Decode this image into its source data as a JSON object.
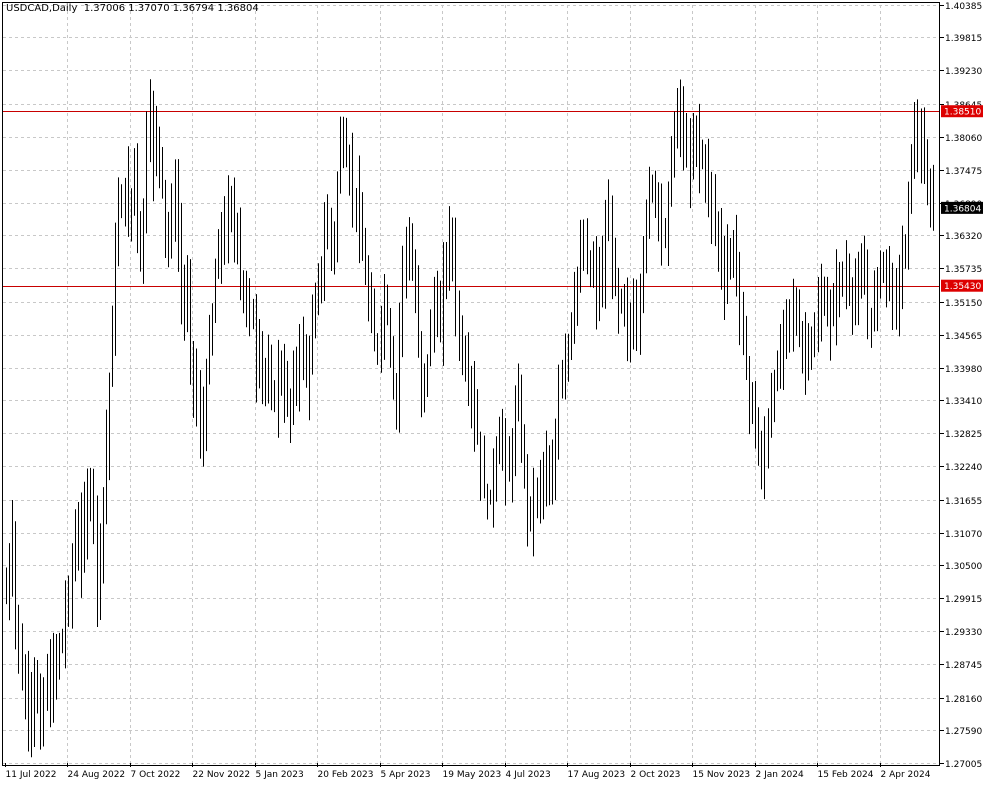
{
  "header": {
    "symbol": "USDCAD,Daily",
    "ohlc": "1.37006 1.37070 1.36794 1.36804"
  },
  "colors": {
    "background": "#ffffff",
    "frame": "#000000",
    "grid": "#c8c8c8",
    "bars": "#000000",
    "level_line": "#c80000",
    "level_label_bg": "#dd0000",
    "current_label_bg": "#000000"
  },
  "chart_data": {
    "type": "ohlc",
    "title": "USDCAD,Daily",
    "ylim": [
      1.27005,
      1.40385
    ],
    "y_ticks": [
      "1.40385",
      "1.39815",
      "1.39230",
      "1.38645",
      "1.38060",
      "1.37475",
      "1.36890",
      "1.36320",
      "1.35735",
      "1.35150",
      "1.34565",
      "1.33980",
      "1.33410",
      "1.32825",
      "1.32240",
      "1.31655",
      "1.31070",
      "1.30500",
      "1.29915",
      "1.29330",
      "1.28745",
      "1.28160",
      "1.27590",
      "1.27005"
    ],
    "x_ticks": [
      "11 Jul 2022",
      "24 Aug 2022",
      "7 Oct 2022",
      "22 Nov 2022",
      "5 Jan 2023",
      "20 Feb 2023",
      "5 Apr 2023",
      "19 May 2023",
      "4 Jul 2023",
      "17 Aug 2023",
      "2 Oct 2023",
      "15 Nov 2023",
      "2 Jan 2024",
      "15 Feb 2024",
      "2 Apr 2024"
    ],
    "levels": [
      {
        "value": 1.3851,
        "label": "1.38510"
      },
      {
        "value": 1.3543,
        "label": "1.35430"
      }
    ],
    "current_price": {
      "value": 1.36804,
      "label": "1.36804"
    },
    "closes": [
      1.3,
      1.305,
      1.31,
      1.296,
      1.29,
      1.285,
      1.28,
      1.283,
      1.278,
      1.285,
      1.281,
      1.275,
      1.282,
      1.286,
      1.279,
      1.289,
      1.287,
      1.291,
      1.292,
      1.297,
      1.3,
      1.305,
      1.311,
      1.306,
      1.312,
      1.31,
      1.317,
      1.319,
      1.314,
      1.301,
      1.309,
      1.317,
      1.326,
      1.337,
      1.348,
      1.36,
      1.367,
      1.37,
      1.372,
      1.365,
      1.37,
      1.377,
      1.366,
      1.358,
      1.368,
      1.381,
      1.385,
      1.376,
      1.381,
      1.378,
      1.372,
      1.364,
      1.362,
      1.368,
      1.37,
      1.362,
      1.354,
      1.35,
      1.353,
      1.343,
      1.338,
      1.333,
      1.328,
      1.33,
      1.338,
      1.344,
      1.349,
      1.356,
      1.36,
      1.365,
      1.361,
      1.369,
      1.367,
      1.363,
      1.365,
      1.356,
      1.351,
      1.353,
      1.349,
      1.348,
      1.34,
      1.344,
      1.339,
      1.338,
      1.337,
      1.336,
      1.334,
      1.34,
      1.338,
      1.335,
      1.334,
      1.332,
      1.338,
      1.339,
      1.344,
      1.342,
      1.338,
      1.342,
      1.346,
      1.351,
      1.355,
      1.358,
      1.362,
      1.366,
      1.361,
      1.363,
      1.372,
      1.38,
      1.38,
      1.377,
      1.374,
      1.371,
      1.37,
      1.364,
      1.36,
      1.356,
      1.351,
      1.348,
      1.344,
      1.344,
      1.348,
      1.352,
      1.349,
      1.343,
      1.336,
      1.335,
      1.347,
      1.358,
      1.362,
      1.359,
      1.357,
      1.352,
      1.344,
      1.335,
      1.339,
      1.341,
      1.347,
      1.352,
      1.349,
      1.346,
      1.356,
      1.359,
      1.363,
      1.361,
      1.35,
      1.346,
      1.342,
      1.34,
      1.338,
      1.336,
      1.33,
      1.328,
      1.322,
      1.318,
      1.316,
      1.317,
      1.321,
      1.325,
      1.327,
      1.327,
      1.322,
      1.321,
      1.326,
      1.332,
      1.334,
      1.326,
      1.322,
      1.315,
      1.314,
      1.316,
      1.318,
      1.319,
      1.322,
      1.321,
      1.317,
      1.32,
      1.327,
      1.337,
      1.339,
      1.343,
      1.344,
      1.348,
      1.352,
      1.356,
      1.359,
      1.361,
      1.359,
      1.356,
      1.357,
      1.353,
      1.356,
      1.356,
      1.363,
      1.366,
      1.359,
      1.354,
      1.351,
      1.352,
      1.349,
      1.347,
      1.346,
      1.35,
      1.348,
      1.354,
      1.36,
      1.365,
      1.372,
      1.372,
      1.371,
      1.369,
      1.363,
      1.363,
      1.371,
      1.377,
      1.38,
      1.387,
      1.383,
      1.38,
      1.378,
      1.375,
      1.378,
      1.383,
      1.377,
      1.377,
      1.374,
      1.372,
      1.368,
      1.365,
      1.363,
      1.358,
      1.355,
      1.359,
      1.36,
      1.36,
      1.358,
      1.35,
      1.344,
      1.339,
      1.335,
      1.333,
      1.33,
      1.324,
      1.321,
      1.326,
      1.33,
      1.334,
      1.337,
      1.339,
      1.342,
      1.346,
      1.35,
      1.349,
      1.35,
      1.348,
      1.346,
      1.342,
      1.343,
      1.344,
      1.345,
      1.344,
      1.349,
      1.352,
      1.351,
      1.349,
      1.348,
      1.351,
      1.354,
      1.355,
      1.356,
      1.355,
      1.354,
      1.352,
      1.353,
      1.354,
      1.356,
      1.354,
      1.35,
      1.348,
      1.352,
      1.355,
      1.358,
      1.359,
      1.357,
      1.354,
      1.352,
      1.353,
      1.355,
      1.358,
      1.362,
      1.37,
      1.378,
      1.381,
      1.38,
      1.378,
      1.374,
      1.371,
      1.369,
      1.368
    ]
  }
}
